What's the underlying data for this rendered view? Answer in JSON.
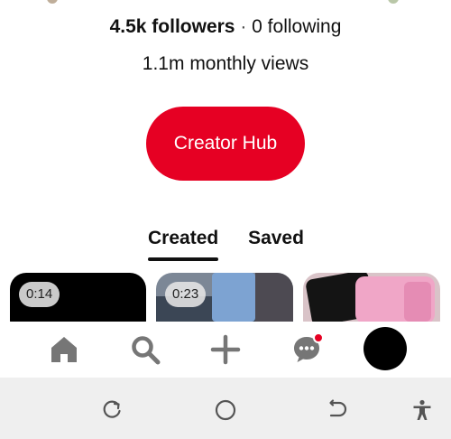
{
  "profile": {
    "followers": "4.5k followers",
    "separator": "·",
    "following": "0 following",
    "monthly_views": "1.1m monthly views",
    "creator_hub_label": "Creator Hub"
  },
  "tabs": [
    {
      "label": "Created",
      "selected": true
    },
    {
      "label": "Saved",
      "selected": false
    }
  ],
  "pins": [
    {
      "duration": "0:14"
    },
    {
      "duration": "0:23"
    },
    {
      "duration": null
    }
  ],
  "bottom_nav": {
    "items": [
      {
        "icon": "home-icon"
      },
      {
        "icon": "search-icon"
      },
      {
        "icon": "plus-icon"
      },
      {
        "icon": "messages-icon",
        "notification": true
      },
      {
        "icon": "profile-avatar"
      }
    ]
  },
  "system_nav": {
    "items": [
      "recents-icon",
      "home-circle-icon",
      "back-icon",
      "accessibility-icon"
    ]
  },
  "colors": {
    "accent": "#e60023",
    "text": "#111111",
    "icon_gray": "#767676",
    "system_bar": "#efefef"
  }
}
